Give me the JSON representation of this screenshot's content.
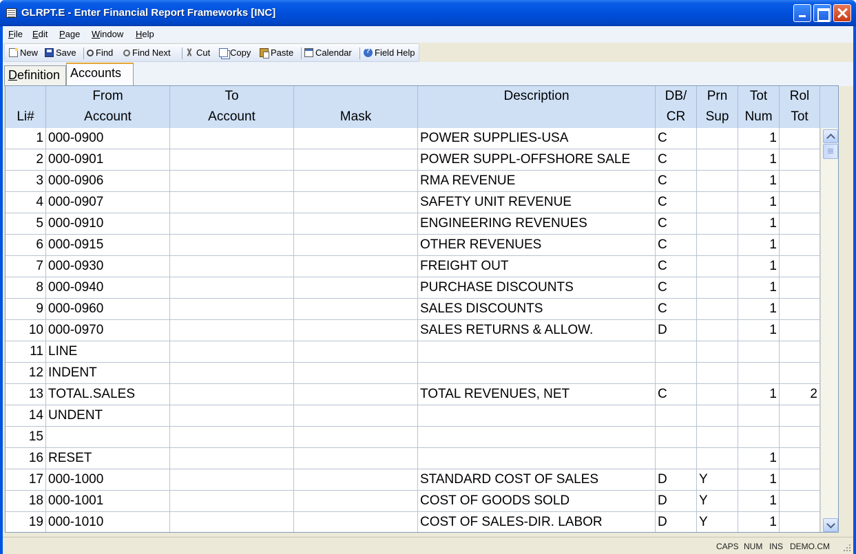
{
  "window": {
    "title": "GLRPT.E - Enter Financial Report Frameworks [INC]"
  },
  "menu": {
    "items": [
      {
        "label": "File",
        "key": "F",
        "rest": "ile"
      },
      {
        "label": "Edit",
        "key": "E",
        "rest": "dit"
      },
      {
        "label": "Page",
        "key": "P",
        "rest": "age"
      },
      {
        "label": "Window",
        "key": "W",
        "rest": "indow"
      },
      {
        "label": "Help",
        "key": "H",
        "rest": "elp"
      }
    ]
  },
  "toolbar": {
    "new": "New",
    "save": "Save",
    "find": "Find",
    "find_next": "Find Next",
    "cut": "Cut",
    "copy": "Copy",
    "paste": "Paste",
    "calendar": "Calendar",
    "field_help": "Field Help"
  },
  "tabs": {
    "definition_key": "D",
    "definition_rest": "efinition",
    "accounts": "Accounts"
  },
  "grid": {
    "headers": {
      "line": [
        "",
        "Li#"
      ],
      "from": [
        "From",
        "Account"
      ],
      "to": [
        "To",
        "Account"
      ],
      "mask": [
        "",
        "Mask"
      ],
      "description": [
        "Description",
        ""
      ],
      "dbcr": [
        "DB/",
        "CR"
      ],
      "prnsup": [
        "Prn",
        "Sup"
      ],
      "totnum": [
        "Tot",
        "Num"
      ],
      "roltot": [
        "Rol",
        "Tot"
      ]
    },
    "rows": [
      {
        "li": "1",
        "from": "000-0900",
        "to": "",
        "mask": "",
        "desc": "POWER SUPPLIES-USA",
        "dbcr": "C",
        "prn": "",
        "tot": "1",
        "rol": ""
      },
      {
        "li": "2",
        "from": "000-0901",
        "to": "",
        "mask": "",
        "desc": "POWER SUPPL-OFFSHORE SALE",
        "dbcr": "C",
        "prn": "",
        "tot": "1",
        "rol": ""
      },
      {
        "li": "3",
        "from": "000-0906",
        "to": "",
        "mask": "",
        "desc": "RMA REVENUE",
        "dbcr": "C",
        "prn": "",
        "tot": "1",
        "rol": ""
      },
      {
        "li": "4",
        "from": "000-0907",
        "to": "",
        "mask": "",
        "desc": "SAFETY UNIT REVENUE",
        "dbcr": "C",
        "prn": "",
        "tot": "1",
        "rol": ""
      },
      {
        "li": "5",
        "from": "000-0910",
        "to": "",
        "mask": "",
        "desc": "ENGINEERING REVENUES",
        "dbcr": "C",
        "prn": "",
        "tot": "1",
        "rol": ""
      },
      {
        "li": "6",
        "from": "000-0915",
        "to": "",
        "mask": "",
        "desc": "OTHER REVENUES",
        "dbcr": "C",
        "prn": "",
        "tot": "1",
        "rol": ""
      },
      {
        "li": "7",
        "from": "000-0930",
        "to": "",
        "mask": "",
        "desc": "FREIGHT OUT",
        "dbcr": "C",
        "prn": "",
        "tot": "1",
        "rol": ""
      },
      {
        "li": "8",
        "from": "000-0940",
        "to": "",
        "mask": "",
        "desc": "PURCHASE DISCOUNTS",
        "dbcr": "C",
        "prn": "",
        "tot": "1",
        "rol": ""
      },
      {
        "li": "9",
        "from": "000-0960",
        "to": "",
        "mask": "",
        "desc": "SALES DISCOUNTS",
        "dbcr": "C",
        "prn": "",
        "tot": "1",
        "rol": ""
      },
      {
        "li": "10",
        "from": "000-0970",
        "to": "",
        "mask": "",
        "desc": "SALES RETURNS & ALLOW.",
        "dbcr": "D",
        "prn": "",
        "tot": "1",
        "rol": ""
      },
      {
        "li": "11",
        "from": "LINE",
        "to": "",
        "mask": "",
        "desc": "",
        "dbcr": "",
        "prn": "",
        "tot": "",
        "rol": ""
      },
      {
        "li": "12",
        "from": "INDENT",
        "to": "",
        "mask": "",
        "desc": "",
        "dbcr": "",
        "prn": "",
        "tot": "",
        "rol": ""
      },
      {
        "li": "13",
        "from": "TOTAL.SALES",
        "to": "",
        "mask": "",
        "desc": "TOTAL REVENUES, NET",
        "dbcr": "C",
        "prn": "",
        "tot": "1",
        "rol": "2"
      },
      {
        "li": "14",
        "from": "UNDENT",
        "to": "",
        "mask": "",
        "desc": "",
        "dbcr": "",
        "prn": "",
        "tot": "",
        "rol": ""
      },
      {
        "li": "15",
        "from": "",
        "to": "",
        "mask": "",
        "desc": "",
        "dbcr": "",
        "prn": "",
        "tot": "",
        "rol": ""
      },
      {
        "li": "16",
        "from": "RESET",
        "to": "",
        "mask": "",
        "desc": "",
        "dbcr": "",
        "prn": "",
        "tot": "1",
        "rol": ""
      },
      {
        "li": "17",
        "from": "000-1000",
        "to": "",
        "mask": "",
        "desc": "STANDARD COST OF SALES",
        "dbcr": "D",
        "prn": "Y",
        "tot": "1",
        "rol": ""
      },
      {
        "li": "18",
        "from": "000-1001",
        "to": "",
        "mask": "",
        "desc": "COST OF GOODS SOLD",
        "dbcr": "D",
        "prn": "Y",
        "tot": "1",
        "rol": ""
      },
      {
        "li": "19",
        "from": "000-1010",
        "to": "",
        "mask": "",
        "desc": "COST OF SALES-DIR. LABOR",
        "dbcr": "D",
        "prn": "Y",
        "tot": "1",
        "rol": ""
      }
    ]
  },
  "status": {
    "caps": "CAPS",
    "num": "NUM",
    "ins": "INS",
    "company": "DEMO.CM"
  },
  "colors": {
    "title_bar": "#0054e3",
    "grid_header": "#cfe0f5",
    "tab_highlight": "#e6a535"
  }
}
